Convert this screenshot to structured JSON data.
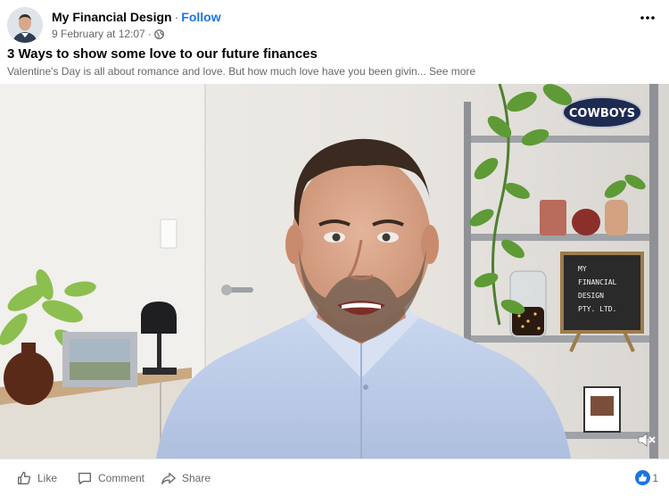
{
  "post": {
    "page_name": "My Financial Design",
    "separator": "·",
    "follow_label": "Follow",
    "timestamp": "9 February at 12:07",
    "meta_separator": "·",
    "title": "3 Ways to show some love to our future finances",
    "description": "Valentine's Day is all about romance and love. But how much love have you been givin...",
    "see_more_label": "See more"
  },
  "video": {
    "letterboard_lines": [
      "MY",
      "FINANCIAL",
      "DESIGN",
      "PTY. LTD."
    ],
    "sign_text": "COWBOYS"
  },
  "actions": {
    "like_label": "Like",
    "comment_label": "Comment",
    "share_label": "Share"
  },
  "reactions": {
    "count": "1"
  },
  "colors": {
    "accent": "#1b74e4",
    "secondary_text": "#65676b",
    "primary_text": "#050505"
  },
  "icons": [
    "globe-icon",
    "more-options-icon",
    "mute-icon",
    "like-icon",
    "comment-icon",
    "share-icon",
    "like-reaction-icon"
  ]
}
